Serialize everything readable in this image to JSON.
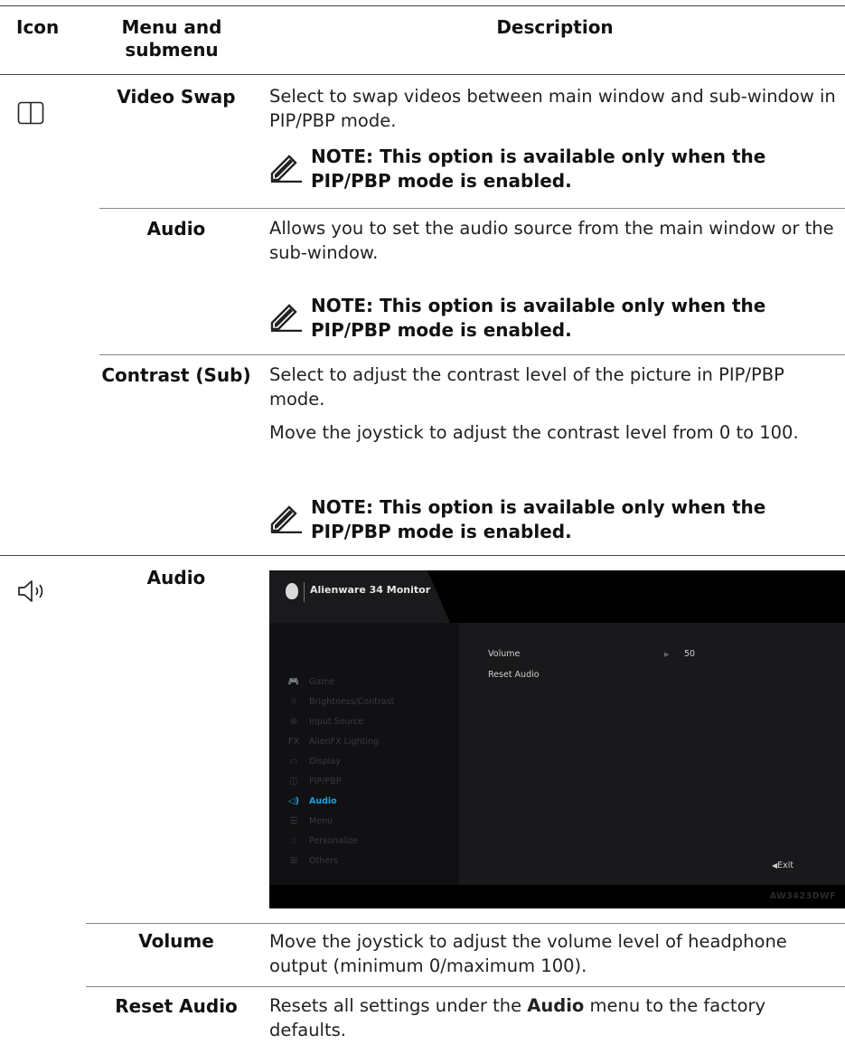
{
  "header": {
    "col_icon": "Icon",
    "col_menu": "Menu and submenu",
    "col_desc": "Description"
  },
  "rows": {
    "video_swap": {
      "name": "Video Swap",
      "desc": "Select to swap videos between main window and sub-window in PIP/PBP mode.",
      "note": "NOTE: This option is available only when the PIP/PBP mode is enabled."
    },
    "audio_sub": {
      "name": "Audio",
      "desc": "Allows you to set the audio source from the main window or the sub-window.",
      "note": "NOTE: This option is available only when the PIP/PBP mode is enabled."
    },
    "contrast_sub": {
      "name": "Contrast (Sub)",
      "desc": "Select to adjust the contrast level of the picture in PIP/PBP mode.",
      "desc2": "Move the joystick to adjust the contrast level from 0 to 100.",
      "note": "NOTE: This option is available only when the PIP/PBP mode is enabled."
    },
    "audio": {
      "name": "Audio"
    },
    "volume": {
      "name": "Volume",
      "desc": "Move the joystick to adjust the volume level of headphone output (minimum 0/maximum 100)."
    },
    "reset_audio": {
      "name": "Reset Audio",
      "desc_before": "Resets all settings under the ",
      "desc_bold": "Audio",
      "desc_after": " menu to the factory defaults."
    }
  },
  "osd": {
    "title": "Alienware 34 Monitor",
    "menu_items": [
      {
        "icon": "gamepad-icon",
        "glyph": "🎮",
        "label": "Game"
      },
      {
        "icon": "brightness-icon",
        "glyph": "☼",
        "label": "Brightness/Contrast"
      },
      {
        "icon": "input-icon",
        "glyph": "⊕",
        "label": "Input Source"
      },
      {
        "icon": "fx-icon",
        "glyph": "FX",
        "label": "AlienFX Lighting"
      },
      {
        "icon": "display-icon",
        "glyph": "▭",
        "label": "Display"
      },
      {
        "icon": "pip-icon",
        "glyph": "◫",
        "label": "PIP/PBP"
      },
      {
        "icon": "speaker-icon",
        "glyph": "◁)",
        "label": "Audio"
      },
      {
        "icon": "menu-icon",
        "glyph": "☰",
        "label": "Menu"
      },
      {
        "icon": "star-icon",
        "glyph": "☆",
        "label": "Personalize"
      },
      {
        "icon": "others-icon",
        "glyph": "⊞",
        "label": "Others"
      }
    ],
    "active_item": "Audio",
    "volume_label": "Volume",
    "volume_value": "50",
    "reset_label": "Reset Audio",
    "exit_label": "Exit",
    "model": "AW3423DWF",
    "accent_color": "#1ea0e0"
  }
}
